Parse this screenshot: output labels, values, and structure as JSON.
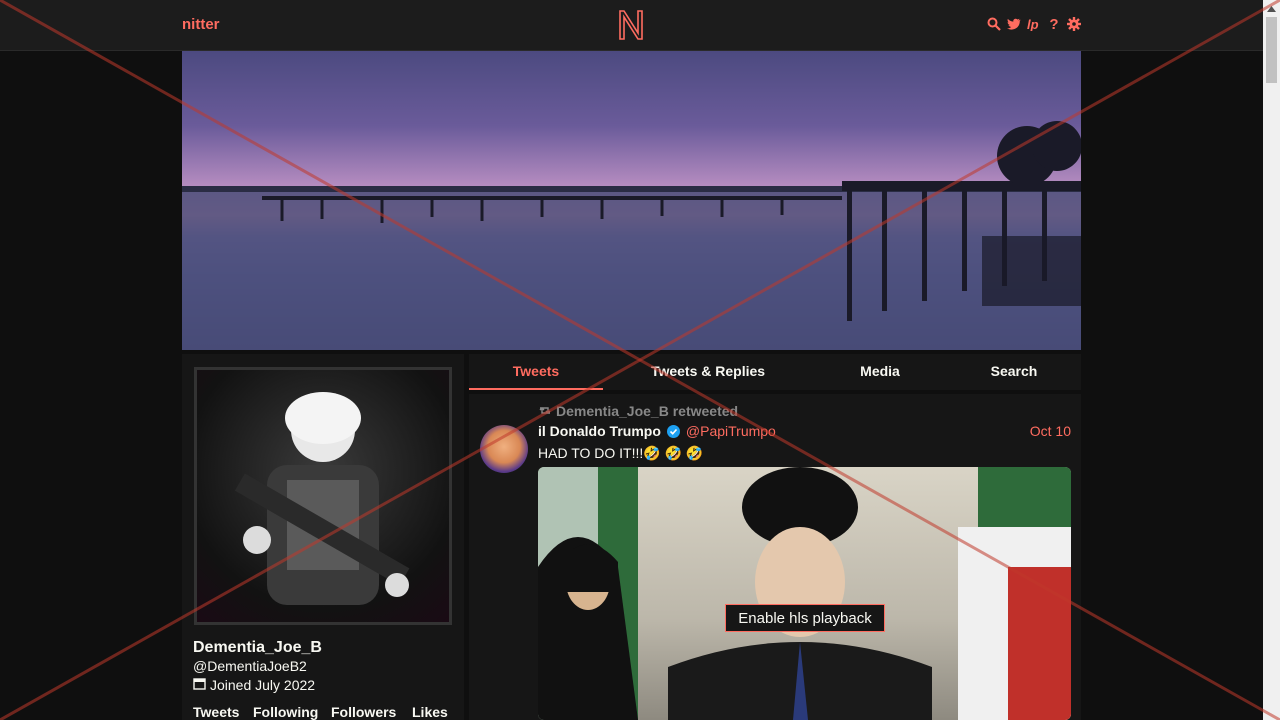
{
  "navbar": {
    "site_name": "nitter",
    "logo_letter": "N",
    "icons": [
      "search-icon",
      "twitter-icon",
      "rss-icon",
      "help-icon",
      "gear-icon"
    ],
    "help_glyph": "?"
  },
  "profile": {
    "fullname": "Dementia_Joe_B",
    "username": "@DementiaJoeB2",
    "joined": "Joined July 2022",
    "stats": [
      "Tweets",
      "Following",
      "Followers",
      "Likes"
    ]
  },
  "tabs": [
    {
      "label": "Tweets",
      "active": true
    },
    {
      "label": "Tweets & Replies",
      "active": false
    },
    {
      "label": "Media",
      "active": false
    },
    {
      "label": "Search",
      "active": false
    }
  ],
  "tweet": {
    "retweet_header": "Dementia_Joe_B retweeted",
    "fullname": "il Donaldo Trumpo",
    "username": "@PapiTrumpo",
    "date": "Oct 10",
    "text": "HAD TO DO IT!!!🤣 🤣 🤣",
    "media_button": "Enable hls playback"
  },
  "colors": {
    "accent": "#ff6c60",
    "background": "#0f0f0f",
    "panel": "#161616",
    "overlay_cross": "#c0392b"
  }
}
